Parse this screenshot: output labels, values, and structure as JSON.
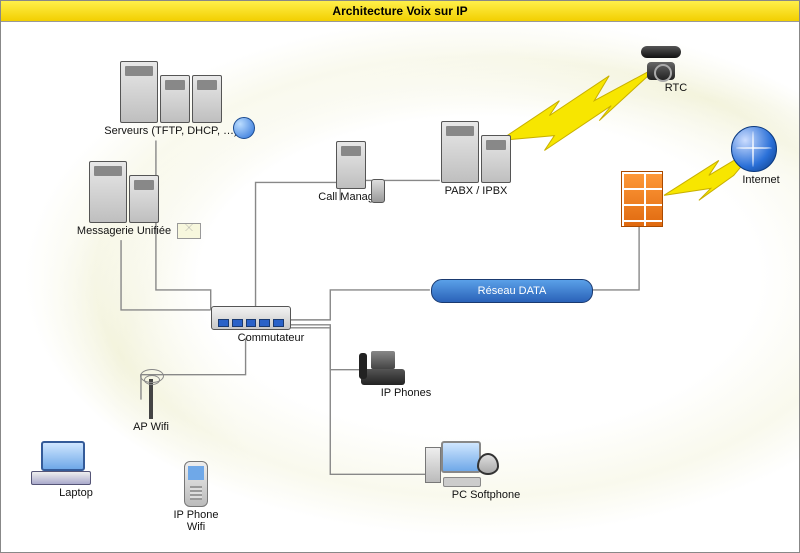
{
  "title": "Architecture Voix sur IP",
  "nodes": {
    "servers": {
      "label": "Serveurs (TFTP, DHCP, …)"
    },
    "messaging": {
      "label": "Messagerie Unifiée"
    },
    "callmanager": {
      "label": "Call Manager"
    },
    "pabx": {
      "label": "PABX / IPBX"
    },
    "switch": {
      "label": "Commutateur"
    },
    "ipphones": {
      "label": "IP Phones"
    },
    "apwifi": {
      "label": "AP Wifi"
    },
    "laptop": {
      "label": "Laptop"
    },
    "ipphonewifi": {
      "label": "IP Phone\nWifi"
    },
    "softphone": {
      "label": "PC Softphone"
    },
    "firewall": {
      "label": ""
    },
    "rtc": {
      "label": "RTC"
    },
    "internet": {
      "label": "Internet"
    },
    "data": {
      "label": "Réseau DATA"
    }
  }
}
